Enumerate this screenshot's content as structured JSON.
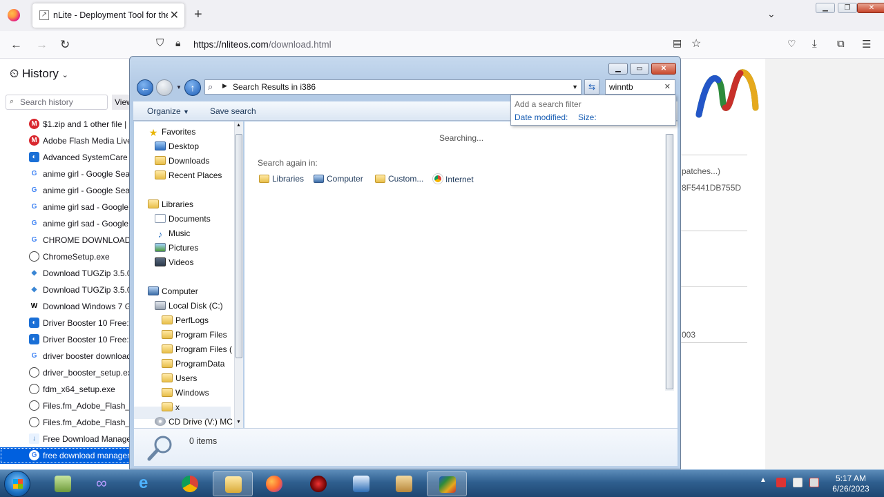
{
  "browser": {
    "tab_title": "nLite - Deployment Tool for the",
    "url_host": "https://nliteos.com",
    "url_path": "/download.html"
  },
  "sidebar": {
    "title": "History",
    "search_placeholder": "Search history",
    "view_label": "View",
    "items": [
      {
        "label": "$1.zip and 1 other file | F",
        "icon": "mega-icon"
      },
      {
        "label": "Adobe Flash Media Live",
        "icon": "mega-icon"
      },
      {
        "label": "Advanced SystemCare F",
        "icon": "iobit-icon"
      },
      {
        "label": "anime girl - Google Sear",
        "icon": "google-icon"
      },
      {
        "label": "anime girl - Google Sear",
        "icon": "google-icon"
      },
      {
        "label": "anime girl sad - Google",
        "icon": "google-icon"
      },
      {
        "label": "anime girl sad - Google",
        "icon": "google-icon"
      },
      {
        "label": "CHROME DOWNLOAD",
        "icon": "google-icon"
      },
      {
        "label": "ChromeSetup.exe",
        "icon": "globe-icon"
      },
      {
        "label": "Download TUGZip 3.5.0",
        "icon": "softpedia-icon"
      },
      {
        "label": "Download TUGZip 3.5.0",
        "icon": "softpedia-icon"
      },
      {
        "label": "Download Windows 7 G",
        "icon": "wikipedia-icon"
      },
      {
        "label": "Driver Booster 10 Free: C",
        "icon": "iobit-icon"
      },
      {
        "label": "Driver Booster 10 Free: C",
        "icon": "iobit-icon"
      },
      {
        "label": "driver booster download",
        "icon": "google-icon"
      },
      {
        "label": "driver_booster_setup.exe",
        "icon": "globe-icon"
      },
      {
        "label": "fdm_x64_setup.exe",
        "icon": "globe-icon"
      },
      {
        "label": "Files.fm_Adobe_Flash_M",
        "icon": "globe-icon"
      },
      {
        "label": "Files.fm_Adobe_Flash_M",
        "icon": "globe-icon"
      },
      {
        "label": "Free Download Manage",
        "icon": "fdm-icon"
      },
      {
        "label": "free download manager",
        "icon": "google-icon"
      }
    ]
  },
  "page_behind": {
    "text_patches": "patches...)",
    "text_hash": "8F5441DB755D",
    "text_year": "003"
  },
  "explorer": {
    "address": "Search Results in i386",
    "search_value": "winntb",
    "organize_label": "Organize",
    "save_search_label": "Save search",
    "filter_title": "Add a search filter",
    "filter_date": "Date modified:",
    "filter_size": "Size:",
    "searching": "Searching...",
    "search_again": "Search again in:",
    "again_items": [
      "Libraries",
      "Computer",
      "Custom...",
      "Internet"
    ],
    "status": "0 items",
    "nav": {
      "favorites": "Favorites",
      "desktop": "Desktop",
      "downloads": "Downloads",
      "recent": "Recent Places",
      "libraries": "Libraries",
      "documents": "Documents",
      "music": "Music",
      "pictures": "Pictures",
      "videos": "Videos",
      "computer": "Computer",
      "local_disk": "Local Disk (C:)",
      "perflogs": "PerfLogs",
      "program_files": "Program Files",
      "program_files_x86": "Program Files (",
      "programdata": "ProgramData",
      "users": "Users",
      "windows": "Windows",
      "x": "x",
      "cd_drive": "CD Drive (V:) MC"
    }
  },
  "taskbar": {
    "time": "5:17 AM",
    "date": "6/26/2023"
  },
  "colors": {
    "selection": "#0060df",
    "taskbar": "#2f5f8f"
  }
}
